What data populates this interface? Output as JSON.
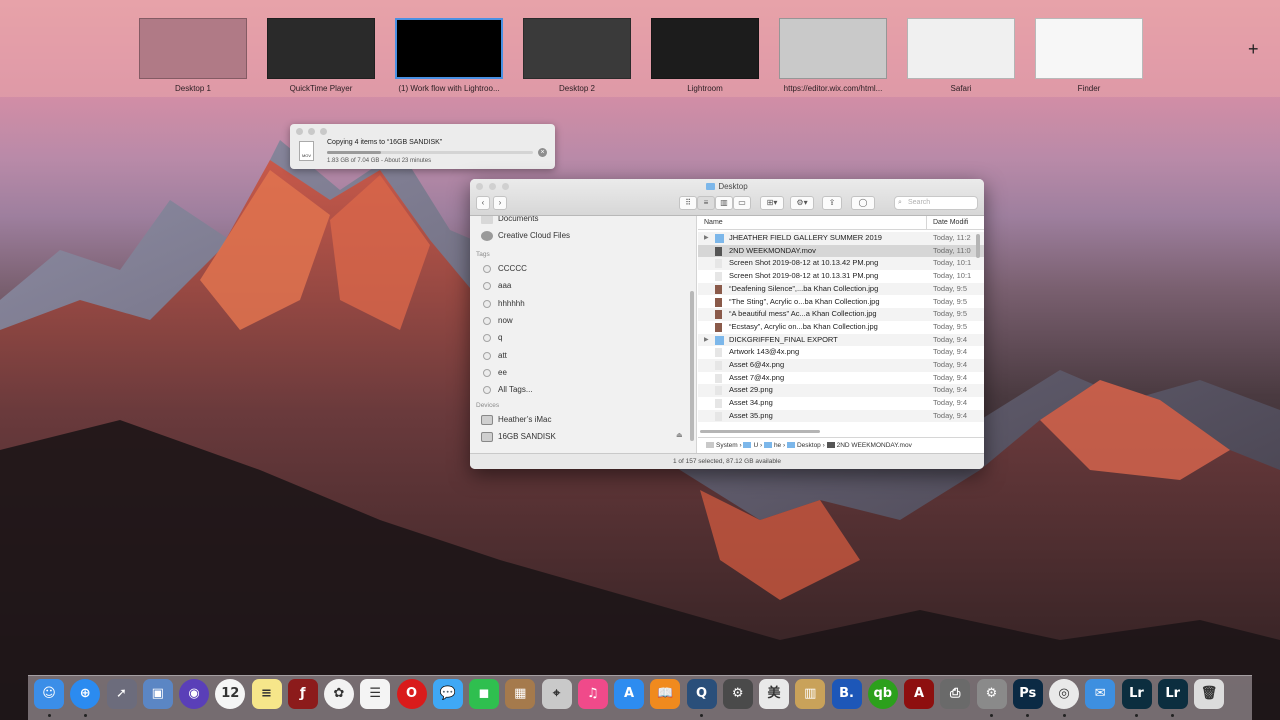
{
  "spaces": [
    {
      "label": "Desktop 1",
      "color": "#b07a86",
      "selected": false
    },
    {
      "label": "QuickTime Player",
      "color": "#2a2a2a",
      "selected": false
    },
    {
      "label": "(1) Work flow with Lightroo...",
      "color": "#000000",
      "selected": true
    },
    {
      "label": "Desktop 2",
      "color": "#3a3a3a",
      "selected": false
    },
    {
      "label": "Lightroom",
      "color": "#1c1c1c",
      "selected": false
    },
    {
      "label": "https://editor.wix.com/html...",
      "color": "#c9c9c9",
      "selected": false
    },
    {
      "label": "Safari",
      "color": "#f0f0f0",
      "selected": false
    },
    {
      "label": "Finder",
      "color": "#f7f7f7",
      "selected": false
    }
  ],
  "add_space_symbol": "+",
  "copy_dialog": {
    "title": "Copying 4 items to “16GB SANDISK”",
    "status": "1.83 GB of 7.04 GB - About 23 minutes",
    "progress": 0.26,
    "file_icon_label": "MOV",
    "cancel_symbol": "×"
  },
  "finder": {
    "title": "Desktop",
    "search_placeholder": "Search",
    "sidebar": {
      "favorites": [
        {
          "label": "Documents",
          "icon": "document-icon"
        },
        {
          "label": "Creative Cloud Files",
          "icon": "creative-cloud-icon"
        }
      ],
      "tags_header": "Tags",
      "tags": [
        "CCCCC",
        "aaa",
        "hhhhhh",
        "now",
        "q",
        "att",
        "ee",
        "All Tags..."
      ],
      "devices_header": "Devices",
      "devices": [
        {
          "label": "Heather’s iMac",
          "icon": "imac-icon"
        },
        {
          "label": "16GB SANDISK",
          "icon": "drive-icon",
          "eject": "⏏"
        }
      ]
    },
    "columns": {
      "name": "Name",
      "date": "Date Modifi"
    },
    "rows": [
      {
        "name": "JHEATHER FIELD GALLERY SUMMER 2019",
        "date": "Today, 11:2",
        "type": "folder",
        "disclosure": "▶"
      },
      {
        "name": "2ND WEEKMONDAY.mov",
        "date": "Today, 11:0",
        "type": "movie",
        "selected": true
      },
      {
        "name": "Screen Shot 2019-08-12 at 10.13.42 PM.png",
        "date": "Today, 10:1",
        "type": "png"
      },
      {
        "name": "Screen Shot 2019-08-12 at 10.13.31 PM.png",
        "date": "Today, 10:1",
        "type": "png"
      },
      {
        "name": "“Deafening Silence”,...ba Khan Collection.jpg",
        "date": "Today, 9:5",
        "type": "jpg"
      },
      {
        "name": "“The Sting”, Acrylic o...ba Khan Collection.jpg",
        "date": "Today, 9:5",
        "type": "jpg"
      },
      {
        "name": "“A beautiful mess” Ac...a Khan Collection.jpg",
        "date": "Today, 9:5",
        "type": "jpg"
      },
      {
        "name": "“Ecstasy”, Acrylic on...ba Khan Collection.jpg",
        "date": "Today, 9:5",
        "type": "jpg"
      },
      {
        "name": "DICKGRIFFEN_FINAL EXPORT",
        "date": "Today, 9:4",
        "type": "folder",
        "disclosure": "▶"
      },
      {
        "name": "Artwork 143@4x.png",
        "date": "Today, 9:4",
        "type": "png"
      },
      {
        "name": "Asset 6@4x.png",
        "date": "Today, 9:4",
        "type": "png"
      },
      {
        "name": "Asset 7@4x.png",
        "date": "Today, 9:4",
        "type": "png"
      },
      {
        "name": "Asset 29.png",
        "date": "Today, 9:4",
        "type": "png"
      },
      {
        "name": "Asset 34.png",
        "date": "Today, 9:4",
        "type": "png"
      },
      {
        "name": "Asset 35.png",
        "date": "Today, 9:4",
        "type": "png"
      }
    ],
    "path": [
      "System",
      "U",
      "he",
      "Desktop",
      "2ND WEEKMONDAY.mov"
    ],
    "path_sep": "›",
    "status": "1 of 157 selected, 87.12 GB available"
  },
  "dock": [
    {
      "name": "finder-icon",
      "color": "#3b8ee8",
      "glyph": "☺",
      "running": true
    },
    {
      "name": "safari-icon",
      "color": "#2b8bf0",
      "glyph": "⊕",
      "running": true
    },
    {
      "name": "launchpad-icon",
      "color": "#6c6c7c",
      "glyph": "➚",
      "running": false
    },
    {
      "name": "preview-icon",
      "color": "#5b86c4",
      "glyph": "▣",
      "running": false
    },
    {
      "name": "siri-icon",
      "color": "#5a3fb8",
      "glyph": "◉",
      "running": false
    },
    {
      "name": "calendar-icon",
      "color": "#f5f5f5",
      "glyph": "12",
      "running": false
    },
    {
      "name": "notes-icon",
      "color": "#f6e68a",
      "glyph": "≡",
      "running": false
    },
    {
      "name": "flash-icon",
      "color": "#8c1b1b",
      "glyph": "ƒ",
      "running": false
    },
    {
      "name": "photos-icon",
      "color": "#f2f2f2",
      "glyph": "✿",
      "running": false
    },
    {
      "name": "reminders-icon",
      "color": "#f4f4f4",
      "glyph": "☰",
      "running": false
    },
    {
      "name": "opera-icon",
      "color": "#d91b1b",
      "glyph": "O",
      "running": false
    },
    {
      "name": "messages-icon",
      "color": "#3fa8f5",
      "glyph": "💬",
      "running": false
    },
    {
      "name": "facetime-icon",
      "color": "#2fbf4f",
      "glyph": "◼",
      "running": false
    },
    {
      "name": "archive-icon",
      "color": "#a57a4c",
      "glyph": "▦",
      "running": false
    },
    {
      "name": "image-capture-icon",
      "color": "#c9c9c9",
      "glyph": "⌖",
      "running": false
    },
    {
      "name": "itunes-icon",
      "color": "#f04a8a",
      "glyph": "♫",
      "running": false
    },
    {
      "name": "app-store-icon",
      "color": "#2d8cf0",
      "glyph": "A",
      "running": false
    },
    {
      "name": "ibooks-icon",
      "color": "#f08a1e",
      "glyph": "📖",
      "running": false
    },
    {
      "name": "quicktime-icon",
      "color": "#2a4f7a",
      "glyph": "Q",
      "running": true
    },
    {
      "name": "terminal-icon",
      "color": "#4a4a4a",
      "glyph": "⚙",
      "running": false
    },
    {
      "name": "font-book-icon",
      "color": "#e9e9e9",
      "glyph": "美",
      "running": false
    },
    {
      "name": "archive-utility-icon",
      "color": "#c9a25a",
      "glyph": "▥",
      "running": false
    },
    {
      "name": "bbedit-icon",
      "color": "#1d57b8",
      "glyph": "B.",
      "running": false
    },
    {
      "name": "quickbooks-icon",
      "color": "#2ca01c",
      "glyph": "qb",
      "running": false
    },
    {
      "name": "acrobat-icon",
      "color": "#8e0f0f",
      "glyph": "A",
      "running": false
    },
    {
      "name": "printer-icon",
      "color": "#6a6a6a",
      "glyph": "⎙",
      "running": false
    },
    {
      "name": "system-preferences-icon",
      "color": "#8a8a8a",
      "glyph": "⚙",
      "running": true
    },
    {
      "name": "photoshop-icon",
      "color": "#0b2a44",
      "glyph": "Ps",
      "running": true
    },
    {
      "name": "chrome-icon",
      "color": "#e9e9e9",
      "glyph": "◎",
      "running": true
    },
    {
      "name": "mail-icon",
      "color": "#3d8fe0",
      "glyph": "✉",
      "running": false
    },
    {
      "name": "lightroom-icon",
      "color": "#0c2e3f",
      "glyph": "Lr",
      "running": true
    },
    {
      "name": "lightroom-classic-icon",
      "color": "#0c2e3f",
      "glyph": "Lr",
      "running": true
    },
    {
      "name": "trash-icon",
      "color": "#dcdcdc",
      "glyph": "🗑",
      "running": false
    }
  ]
}
